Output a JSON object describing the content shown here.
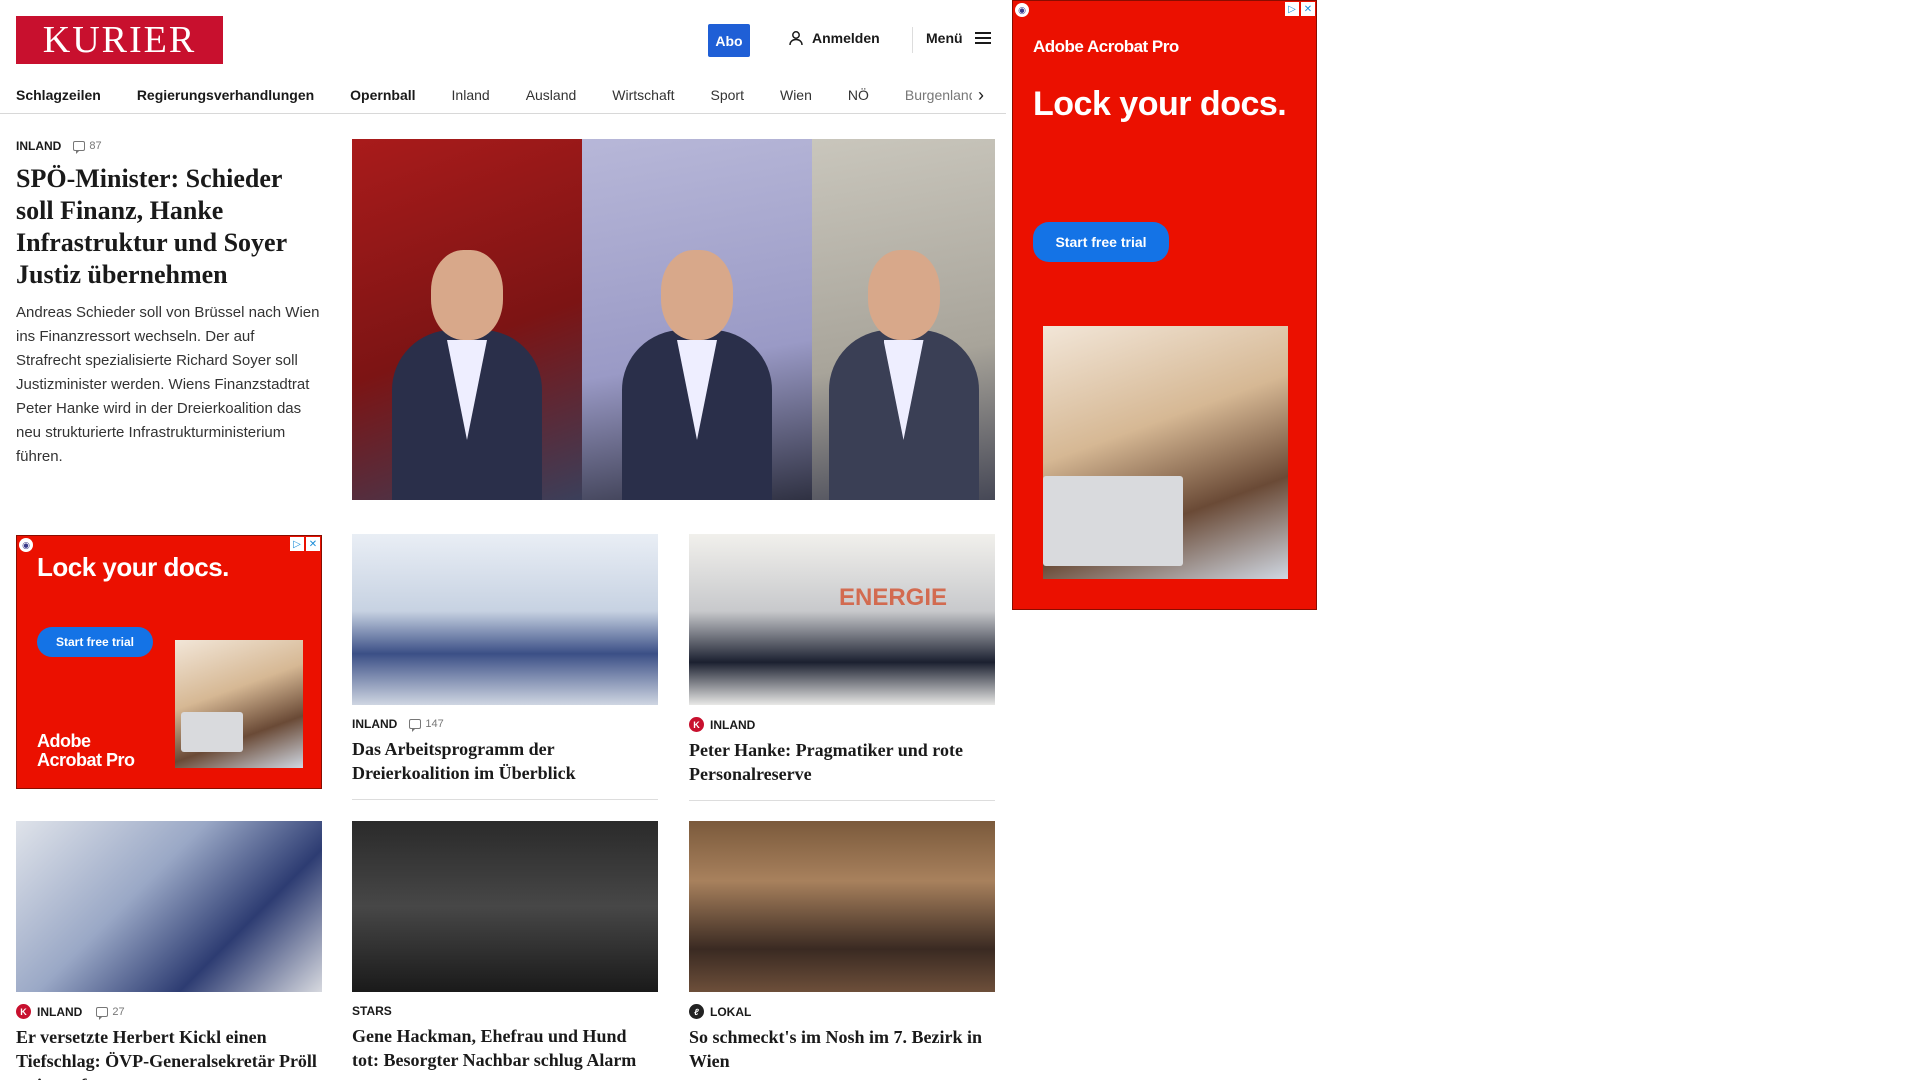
{
  "header": {
    "logo": "KURIER",
    "abo_label": "Abo",
    "login_label": "Anmelden",
    "menu_label": "Menü"
  },
  "nav": {
    "items": [
      "Schlagzeilen",
      "Regierungsverhandlungen",
      "Opernball",
      "Inland",
      "Ausland",
      "Wirtschaft",
      "Sport",
      "Wien",
      "NÖ",
      "Burgenland"
    ]
  },
  "lead": {
    "category": "INLAND",
    "comments": "87",
    "title": "SPÖ-Minister: Schieder soll Finanz, Hanke Infrastruktur und Soyer Justiz übernehmen",
    "teaser": "Andreas Schieder soll von Brüssel nach Wien ins Finanzressort wechseln. Der auf Strafrecht spezialisierte Richard Soyer soll Justizminister werden. Wiens Finanzstadtrat Peter Hanke wird in der Dreierkoalition das neu strukturierte Infrastrukturministerium führen."
  },
  "cards": [
    {
      "category": "INLAND",
      "comments": "147",
      "title": "Das Arbeitsprogramm der Dreierkoalition im Überblick"
    },
    {
      "category": "INLAND",
      "comments": "",
      "title": "Peter Hanke: Pragmatiker und rote Personalreserve"
    },
    {
      "category": "INLAND",
      "comments": "27",
      "title": "Er versetzte Herbert Kickl einen Tiefschlag: ÖVP-Generalsekretär Pröll steigt auf"
    },
    {
      "category": "STARS",
      "comments": "",
      "title": "Gene Hackman, Ehefrau und Hund tot: Besorgter Nachbar schlug Alarm"
    },
    {
      "category": "LOKAL",
      "comments": "",
      "title": "So schmeckt's im Nosh im 7. Bezirk in Wien"
    }
  ],
  "ads": {
    "brand": "Adobe Acrobat Pro",
    "brand_line1": "Adobe",
    "brand_line2": "Acrobat Pro",
    "headline": "Lock your docs.",
    "cta": "Start free trial",
    "badge_k": "K",
    "badge_l": "ℓ",
    "image_text": "ENERGIE"
  }
}
